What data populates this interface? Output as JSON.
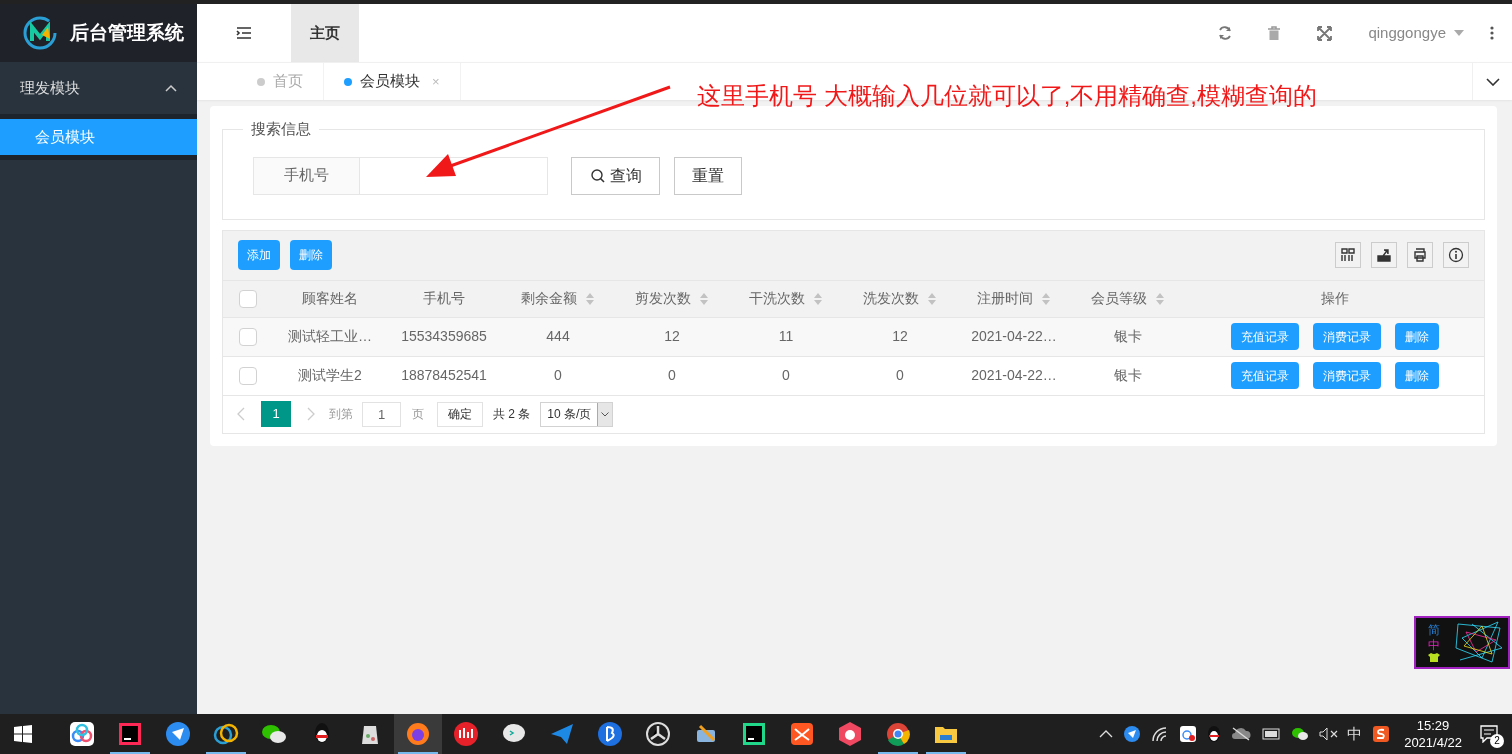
{
  "sidebar": {
    "app_title": "后台管理系统",
    "groups": [
      {
        "label": "理发模块",
        "expanded": true,
        "children": [
          {
            "label": "会员模块",
            "selected": true
          }
        ]
      }
    ]
  },
  "header": {
    "tabs": [
      {
        "label": "主页",
        "selected": true
      }
    ],
    "user": "qinggongye"
  },
  "page_tabs": [
    {
      "label": "首页",
      "selected": false
    },
    {
      "label": "会员模块",
      "selected": true,
      "close": "×"
    }
  ],
  "annotation": "这里手机号 大概输入几位就可以了,不用精确查,模糊查询的",
  "search": {
    "legend": "搜索信息",
    "field_label": "手机号",
    "buttons": [
      "查询",
      "重置"
    ]
  },
  "toolbar": {
    "buttons": [
      "添加",
      "删除"
    ]
  },
  "table": {
    "select_all_checked": false,
    "columns": [
      {
        "label": "顾客姓名",
        "sortable": false
      },
      {
        "label": "手机号",
        "sortable": false
      },
      {
        "label": "剩余金额",
        "sortable": true
      },
      {
        "label": "剪发次数",
        "sortable": true
      },
      {
        "label": "干洗次数",
        "sortable": true
      },
      {
        "label": "洗发次数",
        "sortable": true
      },
      {
        "label": "注册时间",
        "sortable": true
      },
      {
        "label": "会员等级",
        "sortable": true
      },
      {
        "label": "操作",
        "sortable": false
      }
    ],
    "rows": [
      {
        "checked": false,
        "cells": [
          "测试轻工业…",
          "15534359685",
          "444",
          "12",
          "11",
          "12",
          "2021-04-22…",
          "银卡"
        ],
        "actions": [
          "充值记录",
          "消费记录",
          "删除"
        ]
      },
      {
        "checked": false,
        "cells": [
          "测试学生2",
          "18878452541",
          "0",
          "0",
          "0",
          "0",
          "2021-04-22…",
          "银卡"
        ],
        "actions": [
          "充值记录",
          "消费记录",
          "删除"
        ]
      }
    ]
  },
  "pagination": {
    "pages": [
      {
        "label": "1",
        "selected": true
      }
    ],
    "goto_label": "到第",
    "goto_value": "1",
    "page_unit": "页",
    "confirm": "确定",
    "total": "共 2 条",
    "page_size": "10 条/页"
  },
  "ime_widget": {
    "line_1": "简",
    "line_2": "中"
  },
  "taskbar": {
    "apps": [
      {
        "kind": "baidu",
        "running": false,
        "selected": false
      },
      {
        "kind": "idea",
        "running": true,
        "selected": false
      },
      {
        "kind": "feishu",
        "running": false,
        "selected": false
      },
      {
        "kind": "navicat",
        "running": true,
        "selected": false
      },
      {
        "kind": "wechat",
        "running": false,
        "selected": false
      },
      {
        "kind": "qq",
        "running": false,
        "selected": false
      },
      {
        "kind": "jug",
        "running": false,
        "selected": false
      },
      {
        "kind": "firefox",
        "running": true,
        "selected": true
      },
      {
        "kind": "red",
        "running": false,
        "selected": false
      },
      {
        "kind": "chat",
        "running": false,
        "selected": false
      },
      {
        "kind": "plane",
        "running": false,
        "selected": false
      },
      {
        "kind": "bicon",
        "running": false,
        "selected": false
      },
      {
        "kind": "unity",
        "running": false,
        "selected": false
      },
      {
        "kind": "tool",
        "running": false,
        "selected": false
      },
      {
        "kind": "pycharm",
        "running": false,
        "selected": false
      },
      {
        "kind": "orange",
        "running": false,
        "selected": false
      },
      {
        "kind": "hexred",
        "running": false,
        "selected": false
      },
      {
        "kind": "chrome",
        "running": true,
        "selected": false
      },
      {
        "kind": "folder",
        "running": true,
        "selected": false
      }
    ],
    "ime": "中",
    "time": "15:29",
    "date": "2021/4/22",
    "notifications": "2"
  }
}
